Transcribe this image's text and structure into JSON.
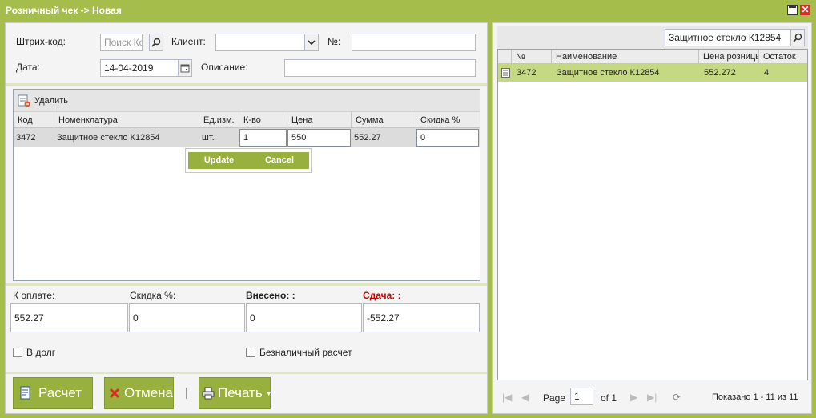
{
  "window": {
    "title": "Розничный чек -> Новая",
    "close_glyph": "✕"
  },
  "form": {
    "barcode_label": "Штрих-код:",
    "barcode_placeholder": "Поиск Код",
    "client_label": "Клиент:",
    "client_value": "",
    "number_label": "№:",
    "number_value": "",
    "date_label": "Дата:",
    "date_value": "14-04-2019",
    "description_label": "Описание:",
    "description_value": ""
  },
  "items_grid": {
    "delete_label": "Удалить",
    "columns": [
      "Код",
      "Номенклатура",
      "Ед.изм.",
      "К-во",
      "Цена",
      "Сумма",
      "Скидка %"
    ],
    "rows": [
      {
        "code": "3472",
        "name": "Защитное стекло К12854",
        "unit": "шт.",
        "qty": "1",
        "price": "550",
        "sum": "552.27",
        "discount": "0"
      }
    ],
    "update_label": "Update",
    "cancel_label": "Cancel"
  },
  "totals": {
    "to_pay_label": "К оплате:",
    "to_pay_value": "552.27",
    "discount_label": "Скидка %:",
    "discount_value": "0",
    "paid_label": "Внесено: :",
    "paid_value": "0",
    "change_label": "Сдача: :",
    "change_value": "-552.27",
    "change_color": "#cc0000",
    "debt_label": "В долг",
    "debt_checked": false,
    "cashless_label": "Безналичный расчет",
    "cashless_checked": false
  },
  "actions": {
    "calc_label": "Расчет",
    "cancel_label": "Отмена",
    "print_label": "Печать"
  },
  "catalog": {
    "search_value": "Защитное стекло К12854",
    "columns": [
      "№",
      "Наименование",
      "Цена розницы",
      "Остаток"
    ],
    "rows": [
      {
        "number": "3472",
        "name": "Защитное стекло К12854",
        "price": "552.272",
        "stock": "4"
      }
    ],
    "pager": {
      "page_label": "Page",
      "page_value": "1",
      "of_label": "of 1",
      "summary": "Показано 1 - 11 из 11"
    }
  },
  "colors": {
    "accent": "#a4bd4b",
    "button": "#97b03e",
    "selected_row": "#c5d983"
  }
}
